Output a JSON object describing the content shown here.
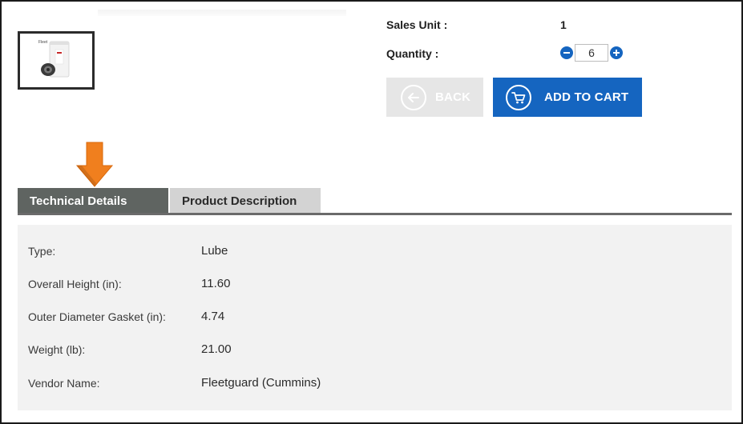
{
  "purchase": {
    "sales_unit_label": "Sales Unit :",
    "sales_unit_value": "1",
    "quantity_label": "Quantity :",
    "quantity_value": "6",
    "back_label": "BACK",
    "add_to_cart_label": "ADD TO CART"
  },
  "thumbnail": {
    "brand_text": "Fleet"
  },
  "tabs": [
    {
      "label": "Technical Details",
      "active": true
    },
    {
      "label": "Product Description",
      "active": false
    }
  ],
  "details": [
    {
      "key": "Type:",
      "value": "Lube"
    },
    {
      "key": "Overall Height (in):",
      "value": "11.60"
    },
    {
      "key": "Outer Diameter Gasket (in):",
      "value": "4.74"
    },
    {
      "key": "Weight (lb):",
      "value": "21.00"
    },
    {
      "key": "Vendor Name:",
      "value": "Fleetguard (Cummins)"
    }
  ],
  "icons": {
    "back": "arrow-left-icon",
    "cart": "shopping-cart-icon",
    "decrease": "minus-circle-icon",
    "increase": "plus-circle-icon",
    "pointer": "down-arrow-icon"
  },
  "colors": {
    "primary_blue": "#1565c0",
    "back_disabled": "#e6e6e6",
    "tab_active": "#5f6461",
    "tab_inactive": "#d3d3d3",
    "panel_bg": "#f2f2f2",
    "arrow_orange": "#f07f1e"
  }
}
